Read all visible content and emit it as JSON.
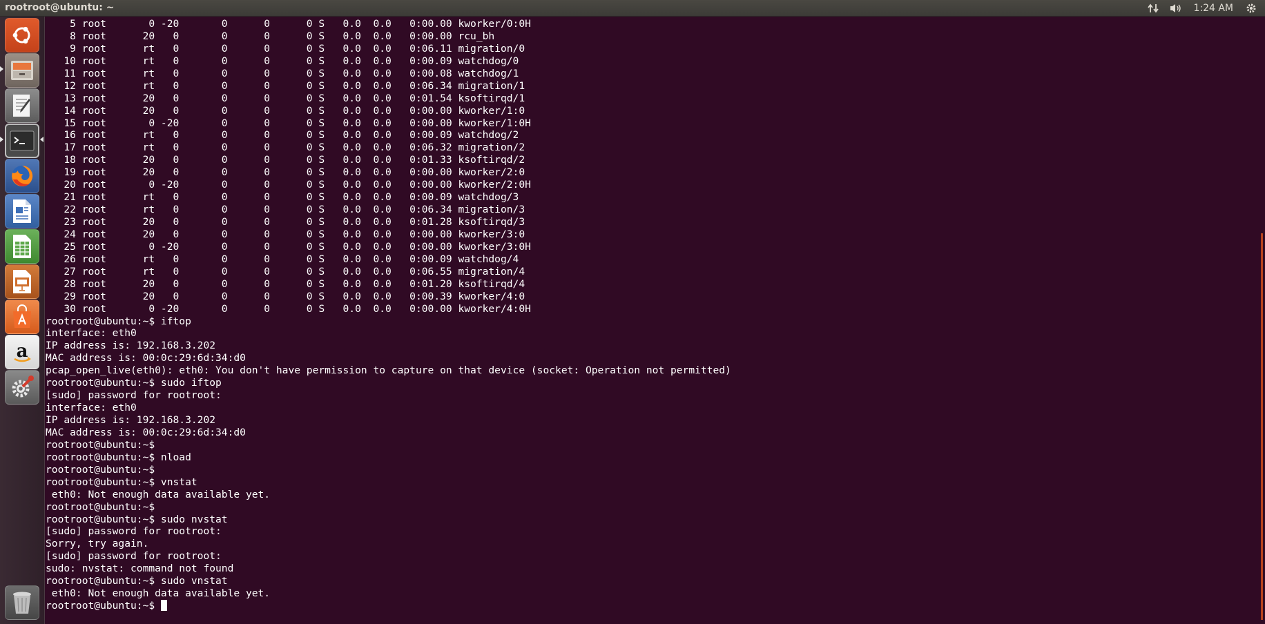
{
  "window": {
    "title": "rootroot@ubuntu: ~"
  },
  "panel": {
    "clock": "1:24 AM",
    "indicators": [
      "network-updown-icon",
      "volume-icon",
      "settings-gear-icon"
    ]
  },
  "launcher": {
    "items": [
      {
        "name": "ubuntu-dash",
        "icon": "ubuntu-logo-icon"
      },
      {
        "name": "files",
        "icon": "file-cabinet-icon"
      },
      {
        "name": "text-editor",
        "icon": "text-editor-icon"
      },
      {
        "name": "terminal",
        "icon": "terminal-icon",
        "active": true
      },
      {
        "name": "firefox",
        "icon": "firefox-icon"
      },
      {
        "name": "libreoffice-writer",
        "icon": "writer-document-icon"
      },
      {
        "name": "libreoffice-calc",
        "icon": "calc-spreadsheet-icon"
      },
      {
        "name": "libreoffice-impress",
        "icon": "impress-presentation-icon"
      },
      {
        "name": "ubuntu-software",
        "icon": "software-bag-icon"
      },
      {
        "name": "amazon",
        "icon": "amazon-icon"
      },
      {
        "name": "system-settings",
        "icon": "wrench-gear-icon"
      },
      {
        "name": "trash",
        "icon": "trash-icon"
      }
    ]
  },
  "terminal": {
    "lines": [
      "    5 root       0 -20       0      0      0 S   0.0  0.0   0:00.00 kworker/0:0H",
      "    8 root      20   0       0      0      0 S   0.0  0.0   0:00.00 rcu_bh",
      "    9 root      rt   0       0      0      0 S   0.0  0.0   0:06.11 migration/0",
      "   10 root      rt   0       0      0      0 S   0.0  0.0   0:00.09 watchdog/0",
      "   11 root      rt   0       0      0      0 S   0.0  0.0   0:00.08 watchdog/1",
      "   12 root      rt   0       0      0      0 S   0.0  0.0   0:06.34 migration/1",
      "   13 root      20   0       0      0      0 S   0.0  0.0   0:01.54 ksoftirqd/1",
      "   14 root      20   0       0      0      0 S   0.0  0.0   0:00.00 kworker/1:0",
      "   15 root       0 -20       0      0      0 S   0.0  0.0   0:00.00 kworker/1:0H",
      "   16 root      rt   0       0      0      0 S   0.0  0.0   0:00.09 watchdog/2",
      "   17 root      rt   0       0      0      0 S   0.0  0.0   0:06.32 migration/2",
      "   18 root      20   0       0      0      0 S   0.0  0.0   0:01.33 ksoftirqd/2",
      "   19 root      20   0       0      0      0 S   0.0  0.0   0:00.00 kworker/2:0",
      "   20 root       0 -20       0      0      0 S   0.0  0.0   0:00.00 kworker/2:0H",
      "   21 root      rt   0       0      0      0 S   0.0  0.0   0:00.09 watchdog/3",
      "   22 root      rt   0       0      0      0 S   0.0  0.0   0:06.34 migration/3",
      "   23 root      20   0       0      0      0 S   0.0  0.0   0:01.28 ksoftirqd/3",
      "   24 root      20   0       0      0      0 S   0.0  0.0   0:00.00 kworker/3:0",
      "   25 root       0 -20       0      0      0 S   0.0  0.0   0:00.00 kworker/3:0H",
      "   26 root      rt   0       0      0      0 S   0.0  0.0   0:00.09 watchdog/4",
      "   27 root      rt   0       0      0      0 S   0.0  0.0   0:06.55 migration/4",
      "   28 root      20   0       0      0      0 S   0.0  0.0   0:01.20 ksoftirqd/4",
      "   29 root      20   0       0      0      0 S   0.0  0.0   0:00.39 kworker/4:0",
      "   30 root       0 -20       0      0      0 S   0.0  0.0   0:00.00 kworker/4:0H",
      "rootroot@ubuntu:~$ iftop",
      "interface: eth0",
      "IP address is: 192.168.3.202",
      "MAC address is: 00:0c:29:6d:34:d0",
      "pcap_open_live(eth0): eth0: You don't have permission to capture on that device (socket: Operation not permitted)",
      "rootroot@ubuntu:~$ sudo iftop",
      "[sudo] password for rootroot:",
      "interface: eth0",
      "IP address is: 192.168.3.202",
      "MAC address is: 00:0c:29:6d:34:d0",
      "rootroot@ubuntu:~$",
      "rootroot@ubuntu:~$ nload",
      "rootroot@ubuntu:~$",
      "rootroot@ubuntu:~$ vnstat",
      " eth0: Not enough data available yet.",
      "rootroot@ubuntu:~$",
      "rootroot@ubuntu:~$ sudo nvstat",
      "[sudo] password for rootroot:",
      "Sorry, try again.",
      "[sudo] password for rootroot:",
      "sudo: nvstat: command not found",
      "rootroot@ubuntu:~$ sudo vnstat",
      " eth0: Not enough data available yet."
    ],
    "prompt": "rootroot@ubuntu:~$ "
  },
  "colors": {
    "terminal_bg": "#300a24",
    "terminal_fg": "#ffffff",
    "panel_bg": "#3c3b37",
    "accent": "#e95420"
  }
}
